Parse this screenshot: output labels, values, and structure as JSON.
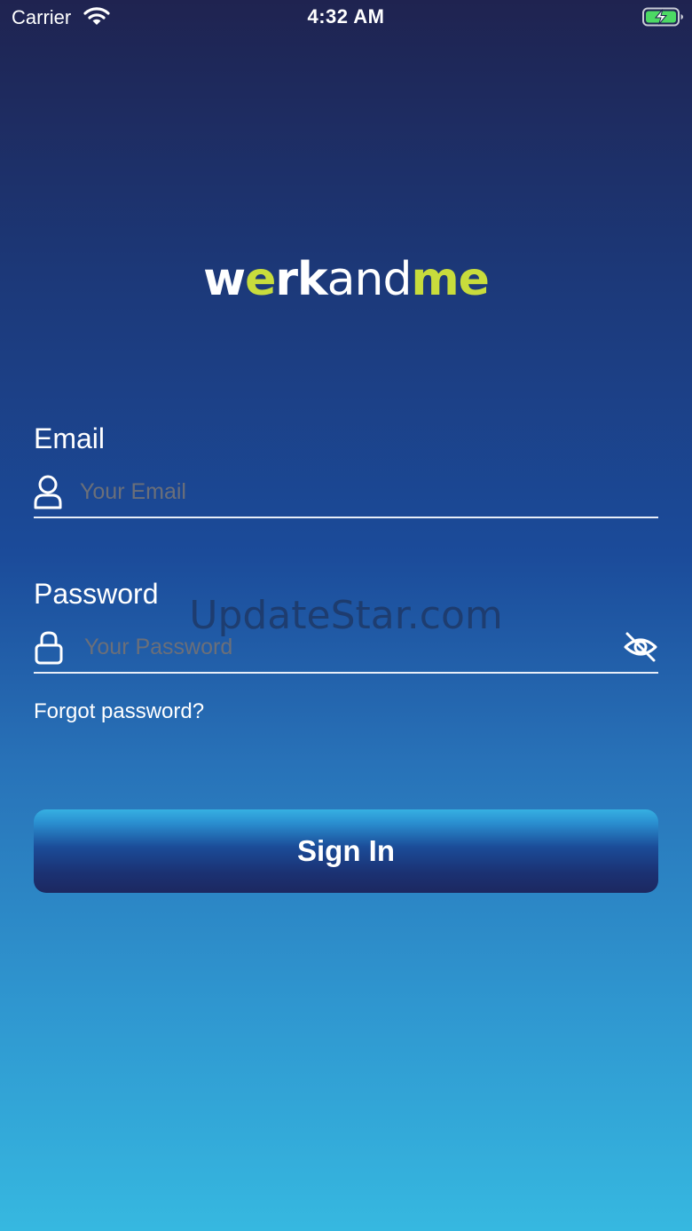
{
  "status_bar": {
    "carrier": "Carrier",
    "time": "4:32 AM"
  },
  "logo": {
    "part_w": "w",
    "part_e": "e",
    "part_rk": "rk",
    "part_and": "and",
    "part_me": "me"
  },
  "form": {
    "email_label": "Email",
    "email_placeholder": "Your Email",
    "password_label": "Password",
    "password_placeholder": "Your Password",
    "forgot_password": "Forgot password?",
    "sign_in": "Sign In"
  },
  "watermark": "UpdateStar.com",
  "colors": {
    "logo_accent": "#c8dc3c",
    "background_top": "#1f2350",
    "background_bottom": "#36b8e0",
    "placeholder": "#6b6f79"
  },
  "icons": {
    "wifi": "wifi-icon",
    "battery": "battery-charging-icon",
    "email_field": "user-icon",
    "password_field": "lock-icon",
    "toggle_password": "eye-off-icon"
  }
}
